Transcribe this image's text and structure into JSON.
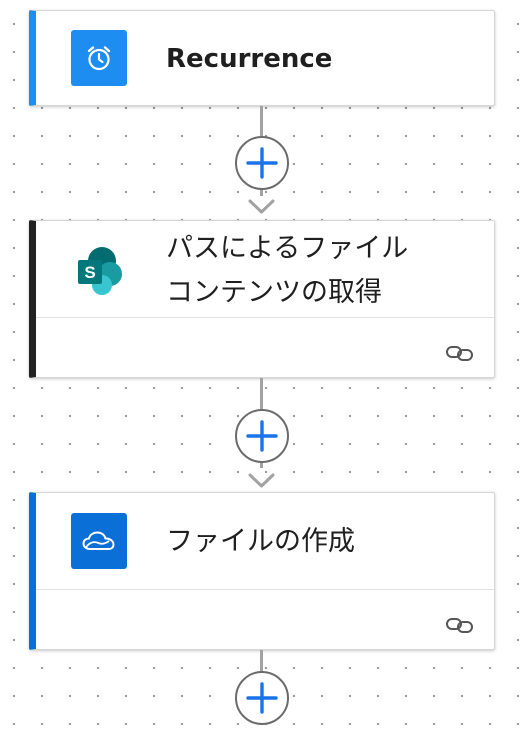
{
  "flow": {
    "steps": [
      {
        "title": "Recurrence",
        "icon": "alarm-clock-icon",
        "accent_color": "#1d8df1",
        "icon_bg": "#1d8df1"
      },
      {
        "title_line1": "パスによるファイル",
        "title_line2": "コンテンツの取得",
        "icon": "sharepoint-icon",
        "accent_color": "#222222"
      },
      {
        "title": "ファイルの作成",
        "icon": "onedrive-icon",
        "accent_color": "#0a6fd6",
        "icon_bg": "#0a6fd6"
      }
    ],
    "connector_icon": "link-icon",
    "add_button_icon": "plus-icon",
    "add_button_color": "#1a73e8"
  }
}
